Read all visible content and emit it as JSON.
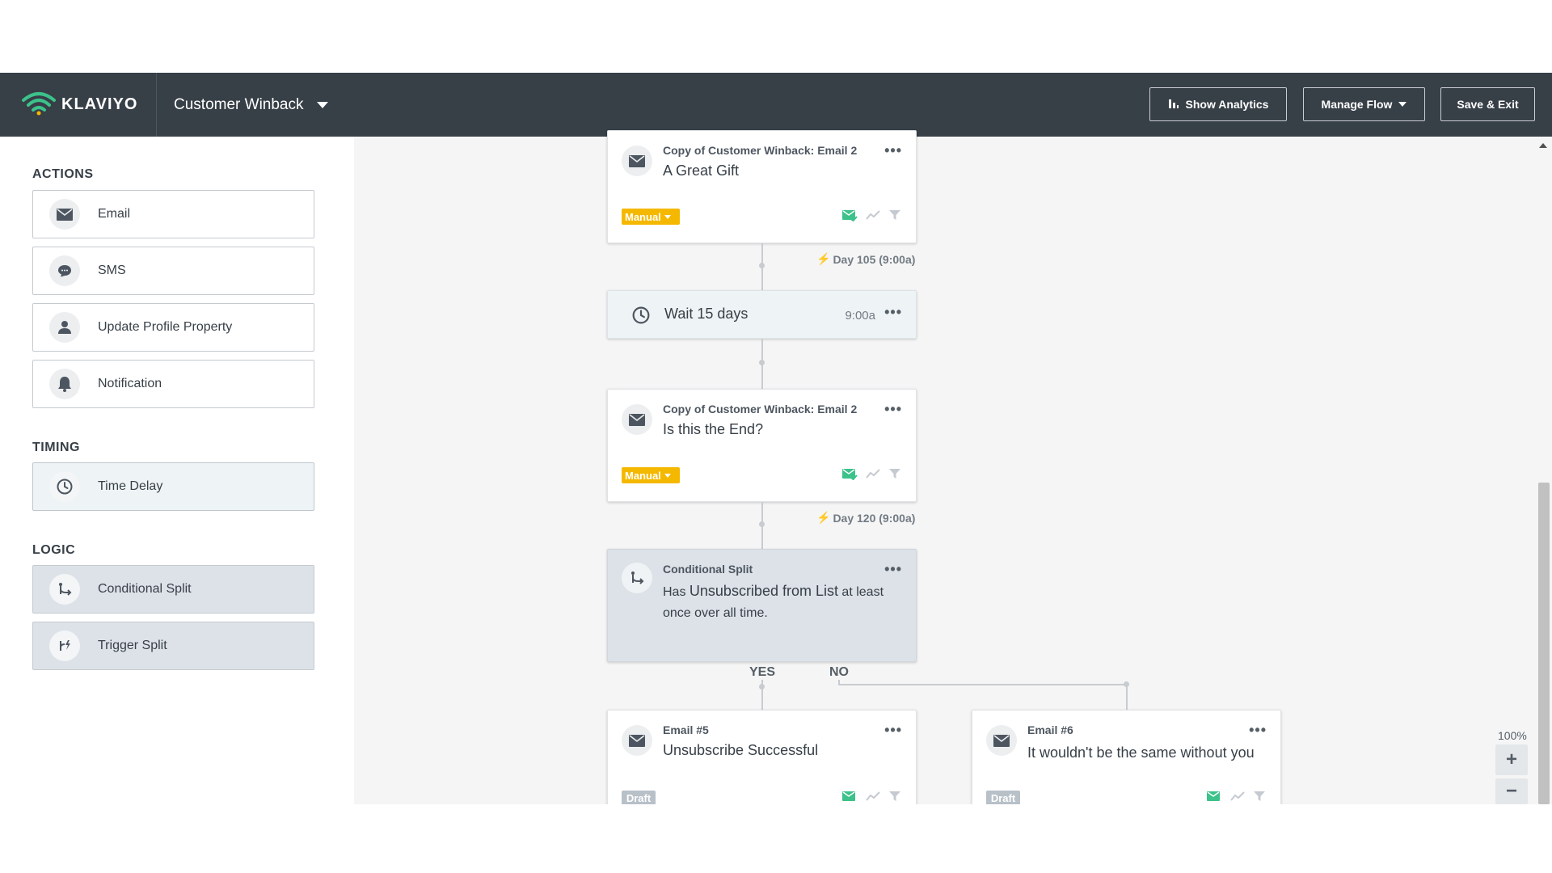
{
  "header": {
    "brand": "KLAVIYO",
    "flow_name": "Customer Winback",
    "show_analytics": "Show Analytics",
    "manage_flow": "Manage Flow",
    "save_exit": "Save & Exit"
  },
  "sidebar": {
    "actions_title": "ACTIONS",
    "actions": [
      {
        "label": "Email",
        "icon": "envelope-icon"
      },
      {
        "label": "SMS",
        "icon": "chat-bubble-icon"
      },
      {
        "label": "Update Profile Property",
        "icon": "person-icon"
      },
      {
        "label": "Notification",
        "icon": "bell-icon"
      }
    ],
    "timing_title": "TIMING",
    "timing": [
      {
        "label": "Time Delay",
        "icon": "clock-icon"
      }
    ],
    "logic_title": "LOGIC",
    "logic": [
      {
        "label": "Conditional Split",
        "icon": "split-icon"
      },
      {
        "label": "Trigger Split",
        "icon": "trigger-split-icon"
      }
    ]
  },
  "canvas": {
    "card1": {
      "subtitle": "Copy of Customer Winback: Email 2",
      "title": "A Great Gift",
      "badge": "Manual"
    },
    "day1": "Day 105 (9:00a)",
    "wait": {
      "title": "Wait 15 days",
      "time": "9:00a"
    },
    "card2": {
      "subtitle": "Copy of Customer Winback: Email 2",
      "title": "Is this the End?",
      "badge": "Manual"
    },
    "day2": "Day 120 (9:00a)",
    "split": {
      "subtitle": "Conditional Split",
      "pre": "Has ",
      "emph": "Unsubscribed from List",
      "post1": " at least",
      "post2": "once over all time."
    },
    "yes_label": "YES",
    "no_label": "NO",
    "email5": {
      "subtitle": "Email #5",
      "title": "Unsubscribe Successful",
      "badge": "Draft"
    },
    "email6": {
      "subtitle": "Email #6",
      "title": "It wouldn't be the same without you",
      "badge": "Draft"
    }
  },
  "zoom": {
    "level": "100%",
    "plus": "+",
    "minus": "−"
  },
  "colors": {
    "header_bg": "#373f47",
    "accent_yellow": "#f5b800",
    "brand_green": "#3cc28a"
  }
}
